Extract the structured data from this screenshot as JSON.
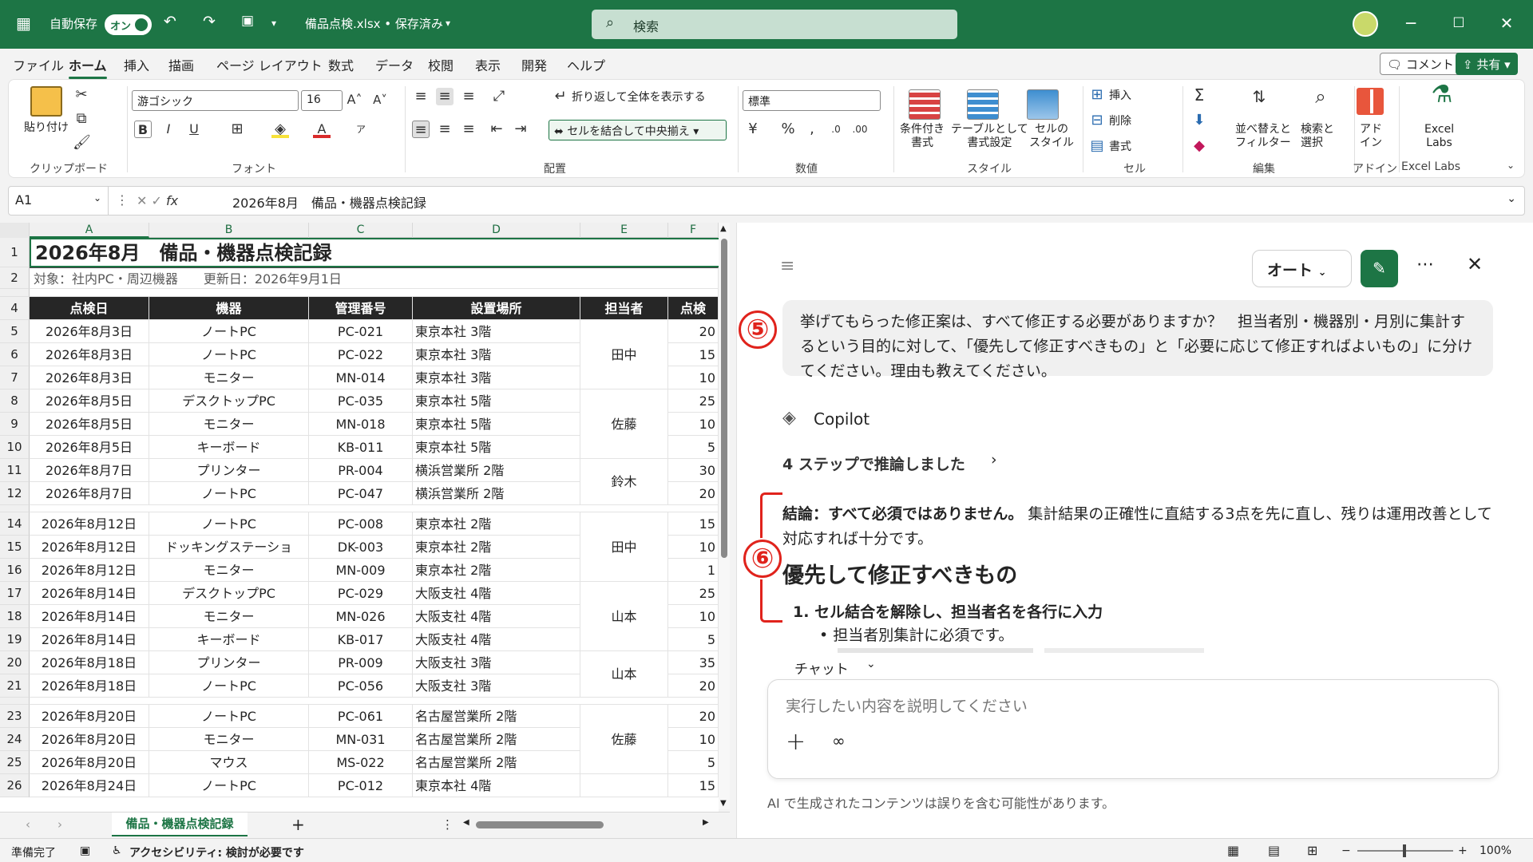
{
  "titlebar": {
    "autosave_label": "自動保存",
    "autosave_state": "オン",
    "filename": "備品点検.xlsx • 保存済み",
    "search_placeholder": "検索"
  },
  "menu": {
    "tabs": [
      "ファイル",
      "ホーム",
      "挿入",
      "描画",
      "ページ レイアウト",
      "数式",
      "データ",
      "校閲",
      "表示",
      "開発",
      "ヘルプ"
    ],
    "active": "ホーム",
    "comment_label": "コメント",
    "share_label": "共有"
  },
  "ribbon": {
    "clipboard": {
      "paste_label": "貼り付け",
      "group": "クリップボード"
    },
    "font": {
      "name": "游ゴシック",
      "size": "16",
      "group": "フォント"
    },
    "alignment": {
      "wrap_label": "折り返して全体を表示する",
      "merge_label": "セルを結合して中央揃え",
      "group": "配置"
    },
    "number": {
      "format": "標準",
      "group": "数値"
    },
    "styles": {
      "cond_format": "条件付き\n書式",
      "table_format": "テーブルとして\n書式設定",
      "cell_style": "セルの\nスタイル",
      "group": "スタイル"
    },
    "cells": {
      "insert": "挿入",
      "delete": "削除",
      "format": "書式",
      "group": "セル"
    },
    "editing": {
      "sort_filter": "並べ替えと\nフィルター",
      "find_select": "検索と\n選択",
      "group": "編集"
    },
    "addins": {
      "label": "アド\nイン",
      "group": "アドイン"
    },
    "excel_labs": {
      "label": "Excel\nLabs",
      "group": "Excel Labs"
    }
  },
  "formula_bar": {
    "name_box": "A1",
    "formula": "2026年8月　備品・機器点検記録"
  },
  "sheet": {
    "columns": [
      "A",
      "B",
      "C",
      "D",
      "E",
      "F"
    ],
    "title": "2026年8月　備品・機器点検記録",
    "subtitle": "対象：社内PC・周辺機器　　更新日：2026年9月1日",
    "headers": [
      "点検日",
      "機器",
      "管理番号",
      "設置場所",
      "担当者",
      "点検"
    ],
    "rows": [
      {
        "num": "5",
        "date": "2026年8月3日",
        "device": "ノートPC",
        "id": "PC-021",
        "place": "東京本社 3階",
        "val": "20"
      },
      {
        "num": "6",
        "date": "2026年8月3日",
        "device": "ノートPC",
        "id": "PC-022",
        "place": "東京本社 3階",
        "val": "15"
      },
      {
        "num": "7",
        "date": "2026年8月3日",
        "device": "モニター",
        "id": "MN-014",
        "place": "東京本社 3階",
        "val": "10"
      },
      {
        "num": "8",
        "date": "2026年8月5日",
        "device": "デスクトップPC",
        "id": "PC-035",
        "place": "東京本社 5階",
        "val": "25"
      },
      {
        "num": "9",
        "date": "2026年8月5日",
        "device": "モニター",
        "id": "MN-018",
        "place": "東京本社 5階",
        "val": "10"
      },
      {
        "num": "10",
        "date": "2026年8月5日",
        "device": "キーボード",
        "id": "KB-011",
        "place": "東京本社 5階",
        "val": "5"
      },
      {
        "num": "11",
        "date": "2026年8月7日",
        "device": "プリンター",
        "id": "PR-004",
        "place": "横浜営業所 2階",
        "val": "30"
      },
      {
        "num": "12",
        "date": "2026年8月7日",
        "device": "ノートPC",
        "id": "PC-047",
        "place": "横浜営業所 2階",
        "val": "20"
      },
      {
        "num": "14",
        "date": "2026年8月12日",
        "device": "ノートPC",
        "id": "PC-008",
        "place": "東京本社 2階",
        "val": "15"
      },
      {
        "num": "15",
        "date": "2026年8月12日",
        "device": "ドッキングステーショ",
        "id": "DK-003",
        "place": "東京本社 2階",
        "val": "10"
      },
      {
        "num": "16",
        "date": "2026年8月12日",
        "device": "モニター",
        "id": "MN-009",
        "place": "東京本社 2階",
        "val": "1"
      },
      {
        "num": "17",
        "date": "2026年8月14日",
        "device": "デスクトップPC",
        "id": "PC-029",
        "place": "大阪支社 4階",
        "val": "25"
      },
      {
        "num": "18",
        "date": "2026年8月14日",
        "device": "モニター",
        "id": "MN-026",
        "place": "大阪支社 4階",
        "val": "10"
      },
      {
        "num": "19",
        "date": "2026年8月14日",
        "device": "キーボード",
        "id": "KB-017",
        "place": "大阪支社 4階",
        "val": "5"
      },
      {
        "num": "20",
        "date": "2026年8月18日",
        "device": "プリンター",
        "id": "PR-009",
        "place": "大阪支社 3階",
        "val": "35"
      },
      {
        "num": "21",
        "date": "2026年8月18日",
        "device": "ノートPC",
        "id": "PC-056",
        "place": "大阪支社 3階",
        "val": "20"
      },
      {
        "num": "23",
        "date": "2026年8月20日",
        "device": "ノートPC",
        "id": "PC-061",
        "place": "名古屋営業所 2階",
        "val": "20"
      },
      {
        "num": "24",
        "date": "2026年8月20日",
        "device": "モニター",
        "id": "MN-031",
        "place": "名古屋営業所 2階",
        "val": "10"
      },
      {
        "num": "25",
        "date": "2026年8月20日",
        "device": "マウス",
        "id": "MS-022",
        "place": "名古屋営業所 2階",
        "val": "5"
      },
      {
        "num": "26",
        "date": "2026年8月24日",
        "device": "ノートPC",
        "id": "PC-012",
        "place": "東京本社 4階",
        "val": "15"
      }
    ],
    "assignees": [
      {
        "name": "田中"
      },
      {
        "name": "佐藤"
      },
      {
        "name": "鈴木"
      },
      {
        "name": "田中"
      },
      {
        "name": "山本"
      },
      {
        "name": "山本"
      },
      {
        "name": "佐藤"
      }
    ],
    "tab_name": "備品・機器点検記録"
  },
  "copilot": {
    "mode": "オート",
    "user_message": "挙げてもらった修正案は、すべて修正する必要がありますか？　担当者別・機器別・月別に集計するという目的に対して、「優先して修正すべきもの」と「必要に応じて修正すればよいもの」に分けてください。理由も教えてください。",
    "name": "Copilot",
    "reasoning": "4 ステップで推論しました",
    "conclusion_bold": "結論：すべて必須ではありません。",
    "conclusion_rest": "集計結果の正確性に直結する3点を先に直し、残りは運用改善として対応すれば十分です。",
    "heading": "優先して修正すべきもの",
    "item1": "セル結合を解除し、担当者名を各行に入力",
    "bullet1": "担当者別集計に必須です。",
    "chat_label": "チャット",
    "input_placeholder": "実行したい内容を説明してください",
    "disclaimer": "AI で生成されたコンテンツは誤りを含む可能性があります。",
    "annot5": "⑤",
    "annot6": "⑥"
  },
  "status": {
    "ready": "準備完了",
    "accessibility": "アクセシビリティ: 検討が必要です",
    "zoom": "100%"
  },
  "colors": {
    "accent": "#1d7545",
    "annotation": "#e0231c"
  }
}
